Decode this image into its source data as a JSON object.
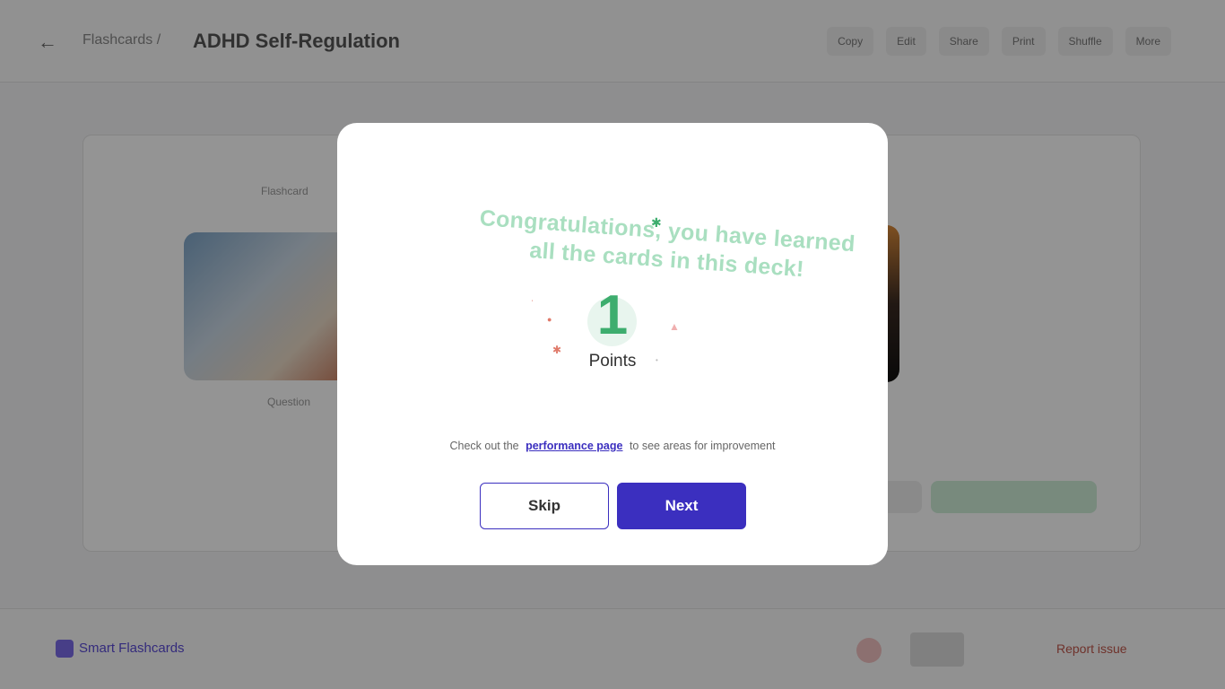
{
  "app": {
    "breadcrumb": "Flashcards /",
    "deck_title": "ADHD Self-Regulation",
    "tools": [
      "Copy",
      "Edit",
      "Share",
      "Print",
      "Shuffle",
      "More"
    ]
  },
  "main": {
    "card_label_top": "Flashcard",
    "card_label_bottom": "Question"
  },
  "bottombar": {
    "brand": "Smart Flashcards",
    "report": "Report issue"
  },
  "modal": {
    "congrats_line1": "Congratulations, you have learned",
    "congrats_line2": "all the cards in this deck!",
    "points_value": "1",
    "points_label": "Points",
    "hint_before": "Check out the",
    "hint_link": "performance page",
    "hint_after": "to see areas for improvement",
    "skip_label": "Skip",
    "next_label": "Next"
  },
  "colors": {
    "accent": "#3b2fbf",
    "points_green": "#3dad6e",
    "congrats_green": "#a9dfc0"
  }
}
